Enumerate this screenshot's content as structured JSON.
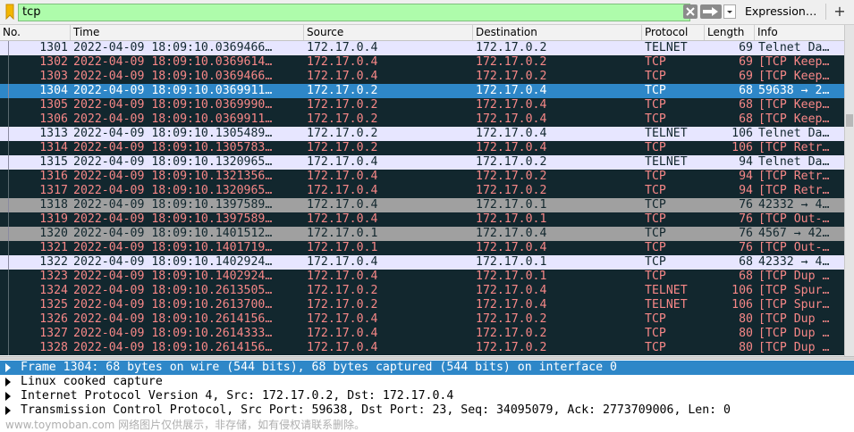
{
  "filter": {
    "value": "tcp",
    "expression_label": "Expression…",
    "plus_label": "+",
    "bar_color": "#aefcab"
  },
  "columns": [
    "No.",
    "Time",
    "Source",
    "Destination",
    "Protocol",
    "Length",
    "Info"
  ],
  "colors": {
    "telnet_bg": "#e7e6ff",
    "telnet_fg": "#12272e",
    "bad_bg": "#12272e",
    "bad_fg": "#f78787",
    "selected_bg": "#2e87c8",
    "selected_fg": "#ffffff",
    "gray_bg": "#a0a0a0",
    "gray_fg": "#12272e"
  },
  "packets": [
    {
      "no": "1301",
      "time": "2022-04-09 18:09:10.0369466…",
      "src": "172.17.0.4",
      "dst": "172.17.0.2",
      "proto": "TELNET",
      "len": "69",
      "info": "Telnet Da…",
      "style": "telnet"
    },
    {
      "no": "1302",
      "time": "2022-04-09 18:09:10.0369614…",
      "src": "172.17.0.4",
      "dst": "172.17.0.2",
      "proto": "TCP",
      "len": "69",
      "info": "[TCP Keep…",
      "style": "bad"
    },
    {
      "no": "1303",
      "time": "2022-04-09 18:09:10.0369466…",
      "src": "172.17.0.4",
      "dst": "172.17.0.2",
      "proto": "TCP",
      "len": "69",
      "info": "[TCP Keep…",
      "style": "bad"
    },
    {
      "no": "1304",
      "time": "2022-04-09 18:09:10.0369911…",
      "src": "172.17.0.2",
      "dst": "172.17.0.4",
      "proto": "TCP",
      "len": "68",
      "info": "59638 → 2…",
      "style": "selected"
    },
    {
      "no": "1305",
      "time": "2022-04-09 18:09:10.0369990…",
      "src": "172.17.0.2",
      "dst": "172.17.0.4",
      "proto": "TCP",
      "len": "68",
      "info": "[TCP Keep…",
      "style": "bad"
    },
    {
      "no": "1306",
      "time": "2022-04-09 18:09:10.0369911…",
      "src": "172.17.0.2",
      "dst": "172.17.0.4",
      "proto": "TCP",
      "len": "68",
      "info": "[TCP Keep…",
      "style": "bad"
    },
    {
      "no": "1313",
      "time": "2022-04-09 18:09:10.1305489…",
      "src": "172.17.0.2",
      "dst": "172.17.0.4",
      "proto": "TELNET",
      "len": "106",
      "info": "Telnet Da…",
      "style": "telnet"
    },
    {
      "no": "1314",
      "time": "2022-04-09 18:09:10.1305783…",
      "src": "172.17.0.2",
      "dst": "172.17.0.4",
      "proto": "TCP",
      "len": "106",
      "info": "[TCP Retr…",
      "style": "bad"
    },
    {
      "no": "1315",
      "time": "2022-04-09 18:09:10.1320965…",
      "src": "172.17.0.4",
      "dst": "172.17.0.2",
      "proto": "TELNET",
      "len": "94",
      "info": "Telnet Da…",
      "style": "telnet"
    },
    {
      "no": "1316",
      "time": "2022-04-09 18:09:10.1321356…",
      "src": "172.17.0.4",
      "dst": "172.17.0.2",
      "proto": "TCP",
      "len": "94",
      "info": "[TCP Retr…",
      "style": "bad"
    },
    {
      "no": "1317",
      "time": "2022-04-09 18:09:10.1320965…",
      "src": "172.17.0.4",
      "dst": "172.17.0.2",
      "proto": "TCP",
      "len": "94",
      "info": "[TCP Retr…",
      "style": "bad"
    },
    {
      "no": "1318",
      "time": "2022-04-09 18:09:10.1397589…",
      "src": "172.17.0.4",
      "dst": "172.17.0.1",
      "proto": "TCP",
      "len": "76",
      "info": "42332 → 4…",
      "style": "gray"
    },
    {
      "no": "1319",
      "time": "2022-04-09 18:09:10.1397589…",
      "src": "172.17.0.4",
      "dst": "172.17.0.1",
      "proto": "TCP",
      "len": "76",
      "info": "[TCP Out-…",
      "style": "bad"
    },
    {
      "no": "1320",
      "time": "2022-04-09 18:09:10.1401512…",
      "src": "172.17.0.1",
      "dst": "172.17.0.4",
      "proto": "TCP",
      "len": "76",
      "info": "4567 → 42…",
      "style": "gray"
    },
    {
      "no": "1321",
      "time": "2022-04-09 18:09:10.1401719…",
      "src": "172.17.0.1",
      "dst": "172.17.0.4",
      "proto": "TCP",
      "len": "76",
      "info": "[TCP Out-…",
      "style": "bad"
    },
    {
      "no": "1322",
      "time": "2022-04-09 18:09:10.1402924…",
      "src": "172.17.0.4",
      "dst": "172.17.0.1",
      "proto": "TCP",
      "len": "68",
      "info": "42332 → 4…",
      "style": "telnet"
    },
    {
      "no": "1323",
      "time": "2022-04-09 18:09:10.1402924…",
      "src": "172.17.0.4",
      "dst": "172.17.0.1",
      "proto": "TCP",
      "len": "68",
      "info": "[TCP Dup …",
      "style": "bad"
    },
    {
      "no": "1324",
      "time": "2022-04-09 18:09:10.2613505…",
      "src": "172.17.0.2",
      "dst": "172.17.0.4",
      "proto": "TELNET",
      "len": "106",
      "info": "[TCP Spur…",
      "style": "bad"
    },
    {
      "no": "1325",
      "time": "2022-04-09 18:09:10.2613700…",
      "src": "172.17.0.2",
      "dst": "172.17.0.4",
      "proto": "TELNET",
      "len": "106",
      "info": "[TCP Spur…",
      "style": "bad"
    },
    {
      "no": "1326",
      "time": "2022-04-09 18:09:10.2614156…",
      "src": "172.17.0.4",
      "dst": "172.17.0.2",
      "proto": "TCP",
      "len": "80",
      "info": "[TCP Dup …",
      "style": "bad"
    },
    {
      "no": "1327",
      "time": "2022-04-09 18:09:10.2614333…",
      "src": "172.17.0.4",
      "dst": "172.17.0.2",
      "proto": "TCP",
      "len": "80",
      "info": "[TCP Dup …",
      "style": "bad"
    },
    {
      "no": "1328",
      "time": "2022-04-09 18:09:10.2614156…",
      "src": "172.17.0.4",
      "dst": "172.17.0.2",
      "proto": "TCP",
      "len": "80",
      "info": "[TCP Dup …",
      "style": "bad"
    }
  ],
  "details": [
    {
      "text": "Frame 1304: 68 bytes on wire (544 bits), 68 bytes captured (544 bits) on interface 0",
      "selected": true
    },
    {
      "text": "Linux cooked capture",
      "selected": false
    },
    {
      "text": "Internet Protocol Version 4, Src: 172.17.0.2, Dst: 172.17.0.4",
      "selected": false
    },
    {
      "text": "Transmission Control Protocol, Src Port: 59638, Dst Port: 23, Seq: 34095079, Ack: 2773709006, Len: 0",
      "selected": false
    }
  ],
  "watermark": "www.toymoban.com 网络图片仅供展示，非存储，如有侵权请联系删除。"
}
